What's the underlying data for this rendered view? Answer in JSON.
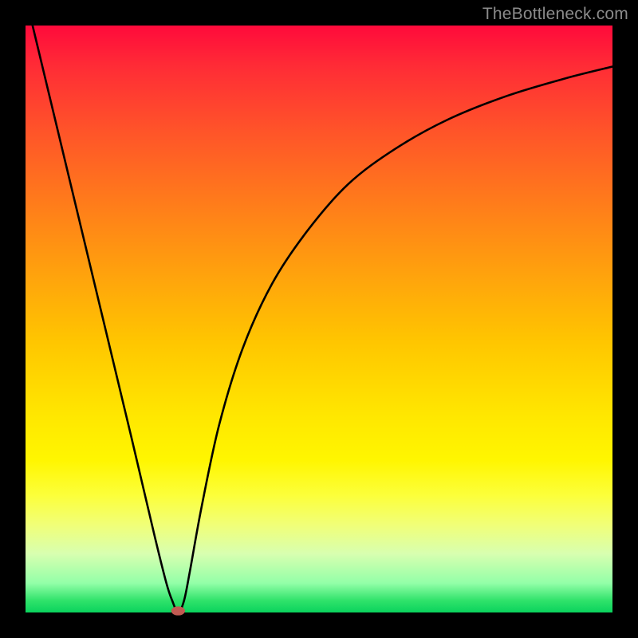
{
  "watermark": "TheBottleneck.com",
  "colors": {
    "frame": "#000000",
    "curve_stroke": "#000000",
    "marker_fill": "#c15a52",
    "marker_stroke": "#c15a52",
    "gradient_stops": [
      "#ff0a3b",
      "#ff5429",
      "#ffa10d",
      "#ffe600",
      "#fff600",
      "#d8ffb0",
      "#0ad35d"
    ]
  },
  "chart_data": {
    "type": "line",
    "title": "",
    "xlabel": "",
    "ylabel": "",
    "xlim": [
      0,
      100
    ],
    "ylim": [
      0,
      100
    ],
    "x": [
      0,
      6,
      12,
      18,
      22,
      24,
      25,
      26,
      27,
      28,
      30,
      33,
      37,
      42,
      48,
      55,
      63,
      72,
      82,
      92,
      100
    ],
    "values": [
      105,
      80,
      55,
      30,
      13,
      5,
      2,
      0,
      2,
      7,
      18,
      32,
      45,
      56,
      65,
      73,
      79,
      84,
      88,
      91,
      93
    ],
    "marker": {
      "x": 26,
      "y": 0,
      "rx": 1.1,
      "ry": 0.7
    },
    "notes": "Single black curve descending steeply from top-left to a minimum near x≈26, then rising and flattening toward upper right. Background is a vertical rainbow gradient (red at top through yellow to green at bottom) framed by thick black borders."
  }
}
